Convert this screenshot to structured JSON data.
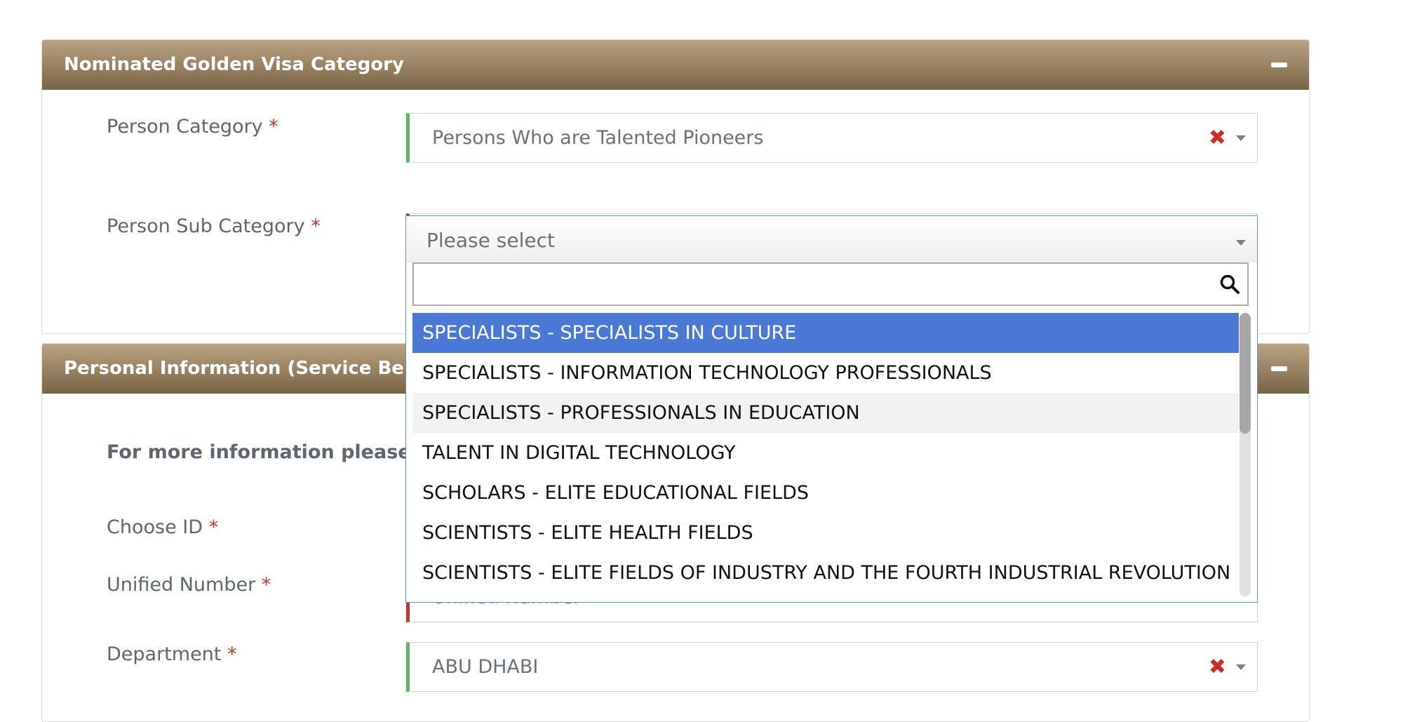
{
  "section1": {
    "title": "Nominated Golden Visa Category",
    "person_category_label": "Person Category",
    "person_category_value": "Persons Who are Talented Pioneers",
    "person_sub_category_label": "Person Sub Category"
  },
  "section2": {
    "title": "Personal Information (Service Benef",
    "info_text": "For more information please che",
    "choose_id_label": "Choose ID",
    "unified_number_label": "Unified Number",
    "unified_number_placeholder": "Unified Number",
    "department_label": "Department",
    "department_value": "ABU DHABI"
  },
  "required_marker": "*",
  "clear_glyph": "✖",
  "dropdown": {
    "placeholder": "Please select",
    "search_value": "",
    "options": [
      "SPECIALISTS - SPECIALISTS IN CULTURE",
      "SPECIALISTS - INFORMATION TECHNOLOGY PROFESSIONALS",
      "SPECIALISTS - PROFESSIONALS IN EDUCATION",
      "TALENT IN DIGITAL TECHNOLOGY",
      "SCHOLARS - ELITE EDUCATIONAL FIELDS",
      "SCIENTISTS - ELITE HEALTH FIELDS",
      "SCIENTISTS - ELITE FIELDS OF INDUSTRY AND THE FOURTH INDUSTRIAL REVOLUTION"
    ],
    "highlighted_index": 0,
    "hovered_index": 2
  },
  "colors": {
    "header_top": "#b9a383",
    "header_bottom": "#786446",
    "highlight": "#4a78d4",
    "valid": "#5cb85c",
    "invalid": "#c9302c",
    "required": "#c0392b"
  },
  "icons": {
    "collapse": "minus-icon",
    "clear": "clear-x-icon",
    "caret": "caret-down-icon",
    "search": "search-icon"
  }
}
